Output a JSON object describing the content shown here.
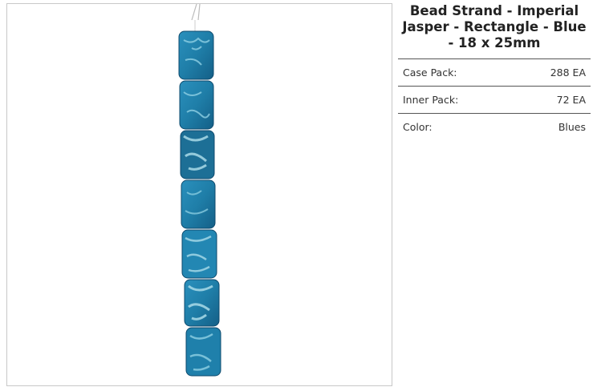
{
  "product": {
    "title": "Bead Strand - Imperial Jasper - Rectangle - Blue - 18 x 25mm",
    "image_alt": "Blue imperial jasper rectangle bead strand"
  },
  "specs": [
    {
      "label": "Case Pack:",
      "value": "288 EA"
    },
    {
      "label": "Inner Pack:",
      "value": "72 EA"
    },
    {
      "label": "Color:",
      "value": "Blues"
    }
  ],
  "colors": {
    "bead_blue": "#1f7ea8",
    "bead_dark": "#0f4f75",
    "bead_light": "#7fc6dc",
    "border": "#c8c8c8"
  }
}
